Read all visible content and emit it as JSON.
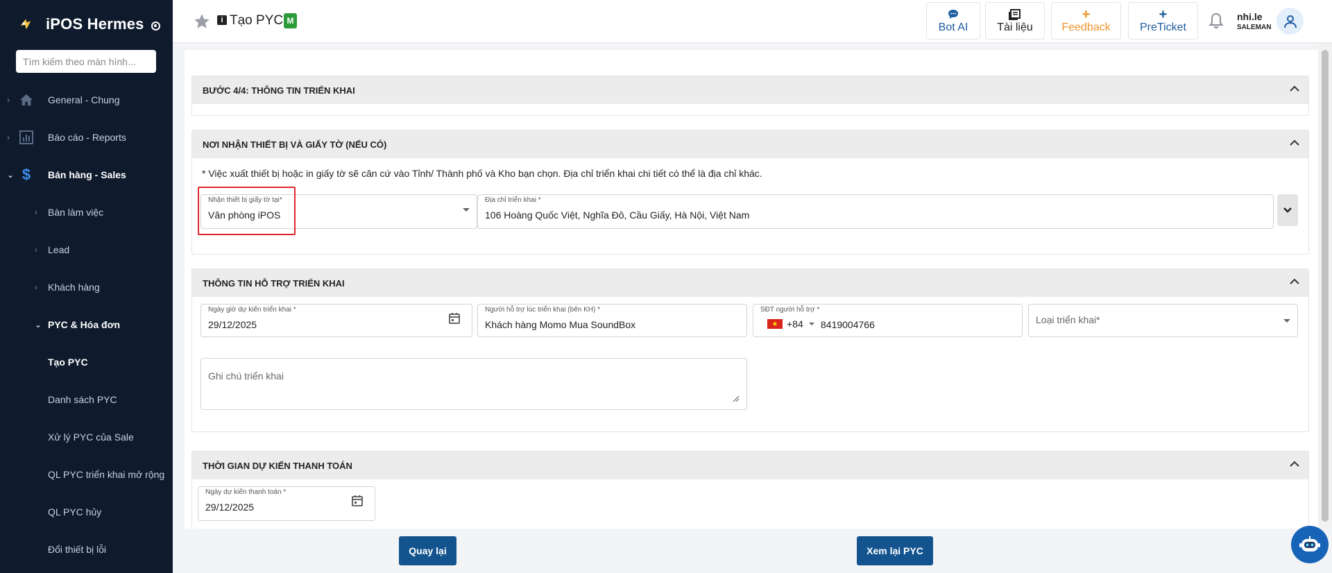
{
  "sidebar": {
    "brand": "iPOS Hermes",
    "search_placeholder": "Tìm kiếm theo màn hình...",
    "items": [
      {
        "label": "General - Chung",
        "icon": "home-icon"
      },
      {
        "label": "Báo cáo - Reports",
        "icon": "chart-icon"
      },
      {
        "label": "Bán hàng - Sales",
        "icon": "dollar-icon"
      },
      {
        "label": "Bàn làm việc"
      },
      {
        "label": "Lead"
      },
      {
        "label": "Khách hàng"
      },
      {
        "label": "PYC & Hóa đơn"
      },
      {
        "label": "Tạo PYC"
      },
      {
        "label": "Danh sách PYC"
      },
      {
        "label": "Xử lý PYC của Sale"
      },
      {
        "label": "QL PYC triển khai mở rộng"
      },
      {
        "label": "QL PYC hủy"
      },
      {
        "label": "Đổi thiết bị lỗi"
      }
    ]
  },
  "header": {
    "info_glyph": "i",
    "title": "Tạo PYC",
    "badge": "M",
    "buttons": {
      "bot_ai": "Bot AI",
      "docs": "Tài liệu",
      "feedback": "Feedback",
      "preticket": "PreTicket",
      "plus": "+"
    },
    "user_name": "nhi.le",
    "user_role": "SALEMAN"
  },
  "step": {
    "title": "BƯỚC 4/4: THÔNG TIN TRIỂN KHAI"
  },
  "receive": {
    "title": "NƠI NHẬN THIẾT BỊ VÀ GIẤY TỜ (NẾU CÓ)",
    "note": "* Việc xuất thiết bị hoặc in giấy tờ sẽ căn cứ vào Tỉnh/ Thành phố và Kho bạn chọn. Địa chỉ triển khai chi tiết có thể là địa chỉ khác.",
    "location_label": "Nhận thiết bị giấy tờ tại*",
    "location_value": "Văn phòng iPOS",
    "address_label": "Địa chỉ triển khai *",
    "address_value": "106 Hoàng Quốc Việt, Nghĩa Đô, Cầu Giấy, Hà Nội, Việt Nam"
  },
  "support": {
    "title": "THÔNG TIN HỖ TRỢ TRIỂN KHAI",
    "date_label": "Ngày giờ dự kiến triển khai *",
    "date_value": "29/12/2025",
    "person_label": "Người hỗ trợ lúc triển khai (bên KH) *",
    "person_value": "Khách hàng Momo Mua SoundBox",
    "phone_label": "SĐT người hỗ trợ *",
    "country_code": "+84",
    "phone_value": "8419004766",
    "type_placeholder": "Loại triển khai*",
    "note_placeholder": "Ghi chú triển khai"
  },
  "payment": {
    "title": "THỜI GIAN DỰ KIẾN THANH TOÁN",
    "date_label": "Ngày dự kiến thanh toán *",
    "date_value": "29/12/2025"
  },
  "footer": {
    "back": "Quay lại",
    "review": "Xem lại PYC"
  },
  "colors": {
    "sidebar_bg": "#0f1b2d",
    "primary": "#13548f",
    "feedback": "#f0932b",
    "highlight": "#e0262b",
    "badge": "#2e9b3a"
  }
}
